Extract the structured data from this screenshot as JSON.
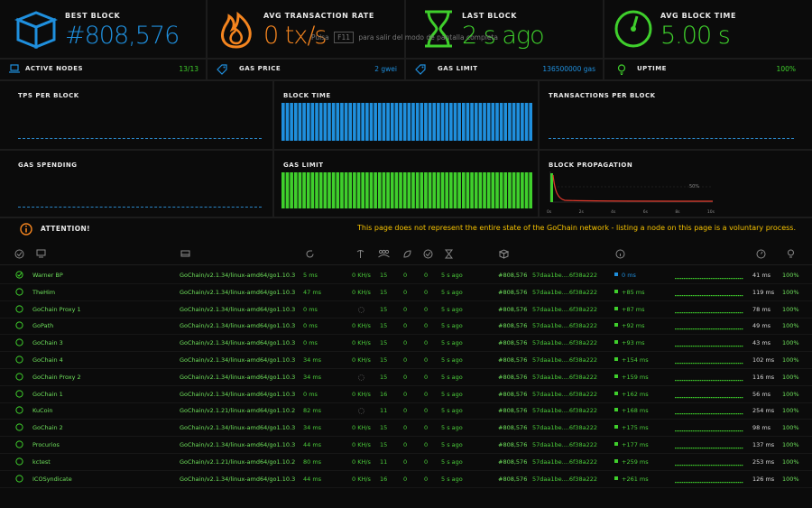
{
  "colors": {
    "blue": "#1f8fdd",
    "orange": "#f5851f",
    "green": "#3fcf2c",
    "yellow": "#f7c300"
  },
  "top_stats": [
    {
      "label": "BEST BLOCK",
      "value": "#808,576",
      "icon": "cube-icon"
    },
    {
      "label": "AVG TRANSACTION RATE",
      "value": "0 tx/s",
      "icon": "flame-icon"
    },
    {
      "label": "LAST BLOCK",
      "value": "2 s ago",
      "icon": "hourglass-icon"
    },
    {
      "label": "AVG BLOCK TIME",
      "value": "5.00 s",
      "icon": "gauge-icon"
    }
  ],
  "overlay_hint": {
    "prefix": "Pulsa",
    "key": "F11",
    "suffix": "para salir del modo de pantalla completa"
  },
  "secondary_stats": [
    {
      "label": "ACTIVE NODES",
      "value": "13/13",
      "icon": "laptop-icon"
    },
    {
      "label": "GAS PRICE",
      "value": "2 gwei",
      "icon": "tag-icon"
    },
    {
      "label": "GAS LIMIT",
      "value": "136500000 gas",
      "icon": "tag-icon"
    },
    {
      "label": "UPTIME",
      "value": "100%",
      "icon": "lightbulb-icon"
    }
  ],
  "panels": {
    "tps": "TPS PER BLOCK",
    "block_time": "BLOCK TIME",
    "tx_per_block": "TRANSACTIONS PER BLOCK",
    "gas_spending": "GAS SPENDING",
    "gas_limit": "GAS LIMIT",
    "block_propagation": "BLOCK PROPAGATION"
  },
  "propagation": {
    "percent_label": "50%",
    "ticks": [
      "0s",
      "2s",
      "4s",
      "6s",
      "8s",
      "10s"
    ]
  },
  "attention": {
    "label": "ATTENTION!",
    "message": "This page does not represent the entire state of the GoChain network - listing a node on this page is a voluntary process."
  },
  "nodes": [
    {
      "name": "Warner BP",
      "client": "GoChain/v2.1.34/linux-amd64/go1.10.3",
      "latency": "5 ms",
      "mining": "0 KH/s",
      "peers": "15",
      "pending": "0",
      "pending2": "0",
      "last": "5 s ago",
      "block": "#808,576",
      "hash": "57daa1be....6f38a222",
      "prop": "0 ms",
      "prop_color": "#1f8fdd",
      "avg_prop": "41 ms",
      "uptime": "100%",
      "pick": false
    },
    {
      "name": "TheHim",
      "client": "GoChain/v2.1.34/linux-amd64/go1.10.3",
      "latency": "47 ms",
      "mining": "0 KH/s",
      "peers": "15",
      "pending": "0",
      "pending2": "0",
      "last": "5 s ago",
      "block": "#808,576",
      "hash": "57daa1be....6f38a222",
      "prop": "+85 ms",
      "prop_color": "#3fcf2c",
      "avg_prop": "119 ms",
      "uptime": "100%",
      "pick": false
    },
    {
      "name": "GoChain Proxy 1",
      "client": "GoChain/v2.1.34/linux-amd64/go1.10.3",
      "latency": "0 ms",
      "mining": "",
      "peers": "15",
      "pending": "0",
      "pending2": "0",
      "last": "5 s ago",
      "block": "#808,576",
      "hash": "57daa1be....6f38a222",
      "prop": "+87 ms",
      "prop_color": "#3fcf2c",
      "avg_prop": "78 ms",
      "uptime": "100%",
      "pick": true
    },
    {
      "name": "GoPath",
      "client": "GoChain/v2.1.34/linux-amd64/go1.10.3",
      "latency": "0 ms",
      "mining": "0 KH/s",
      "peers": "15",
      "pending": "0",
      "pending2": "0",
      "last": "5 s ago",
      "block": "#808,576",
      "hash": "57daa1be....6f38a222",
      "prop": "+92 ms",
      "prop_color": "#3fcf2c",
      "avg_prop": "49 ms",
      "uptime": "100%",
      "pick": false
    },
    {
      "name": "GoChain 3",
      "client": "GoChain/v2.1.34/linux-amd64/go1.10.3",
      "latency": "0 ms",
      "mining": "0 KH/s",
      "peers": "15",
      "pending": "0",
      "pending2": "0",
      "last": "5 s ago",
      "block": "#808,576",
      "hash": "57daa1be....6f38a222",
      "prop": "+93 ms",
      "prop_color": "#3fcf2c",
      "avg_prop": "43 ms",
      "uptime": "100%",
      "pick": false
    },
    {
      "name": "GoChain 4",
      "client": "GoChain/v2.1.34/linux-amd64/go1.10.3",
      "latency": "34 ms",
      "mining": "0 KH/s",
      "peers": "15",
      "pending": "0",
      "pending2": "0",
      "last": "5 s ago",
      "block": "#808,576",
      "hash": "57daa1be....6f38a222",
      "prop": "+154 ms",
      "prop_color": "#3fcf2c",
      "avg_prop": "102 ms",
      "uptime": "100%",
      "pick": false
    },
    {
      "name": "GoChain Proxy 2",
      "client": "GoChain/v2.1.34/linux-amd64/go1.10.3",
      "latency": "34 ms",
      "mining": "",
      "peers": "15",
      "pending": "0",
      "pending2": "0",
      "last": "5 s ago",
      "block": "#808,576",
      "hash": "57daa1be....6f38a222",
      "prop": "+159 ms",
      "prop_color": "#3fcf2c",
      "avg_prop": "116 ms",
      "uptime": "100%",
      "pick": true
    },
    {
      "name": "GoChain 1",
      "client": "GoChain/v2.1.34/linux-amd64/go1.10.3",
      "latency": "0 ms",
      "mining": "0 KH/s",
      "peers": "16",
      "pending": "0",
      "pending2": "0",
      "last": "5 s ago",
      "block": "#808,576",
      "hash": "57daa1be....6f38a222",
      "prop": "+162 ms",
      "prop_color": "#3fcf2c",
      "avg_prop": "56 ms",
      "uptime": "100%",
      "pick": false
    },
    {
      "name": "KuCoin",
      "client": "GoChain/v2.1.21/linux-amd64/go1.10.2",
      "latency": "82 ms",
      "mining": "",
      "peers": "11",
      "pending": "0",
      "pending2": "0",
      "last": "5 s ago",
      "block": "#808,576",
      "hash": "57daa1be....6f38a222",
      "prop": "+168 ms",
      "prop_color": "#3fcf2c",
      "avg_prop": "254 ms",
      "uptime": "100%",
      "pick": true
    },
    {
      "name": "GoChain 2",
      "client": "GoChain/v2.1.34/linux-amd64/go1.10.3",
      "latency": "34 ms",
      "mining": "0 KH/s",
      "peers": "15",
      "pending": "0",
      "pending2": "0",
      "last": "5 s ago",
      "block": "#808,576",
      "hash": "57daa1be....6f38a222",
      "prop": "+175 ms",
      "prop_color": "#3fcf2c",
      "avg_prop": "98 ms",
      "uptime": "100%",
      "pick": false
    },
    {
      "name": "Procurios",
      "client": "GoChain/v2.1.34/linux-amd64/go1.10.3",
      "latency": "44 ms",
      "mining": "0 KH/s",
      "peers": "15",
      "pending": "0",
      "pending2": "0",
      "last": "5 s ago",
      "block": "#808,576",
      "hash": "57daa1be....6f38a222",
      "prop": "+177 ms",
      "prop_color": "#3fcf2c",
      "avg_prop": "137 ms",
      "uptime": "100%",
      "pick": false
    },
    {
      "name": "kctest",
      "client": "GoChain/v2.1.21/linux-amd64/go1.10.2",
      "latency": "80 ms",
      "mining": "0 KH/s",
      "peers": "11",
      "pending": "0",
      "pending2": "0",
      "last": "5 s ago",
      "block": "#808,576",
      "hash": "57daa1be....6f38a222",
      "prop": "+259 ms",
      "prop_color": "#3fcf2c",
      "avg_prop": "253 ms",
      "uptime": "100%",
      "pick": false
    },
    {
      "name": "ICOSyndicate",
      "client": "GoChain/v2.1.34/linux-amd64/go1.10.3",
      "latency": "44 ms",
      "mining": "0 KH/s",
      "peers": "16",
      "pending": "0",
      "pending2": "0",
      "last": "5 s ago",
      "block": "#808,576",
      "hash": "57daa1be....6f38a222",
      "prop": "+261 ms",
      "prop_color": "#3fcf2c",
      "avg_prop": "126 ms",
      "uptime": "100%",
      "pick": false
    }
  ]
}
